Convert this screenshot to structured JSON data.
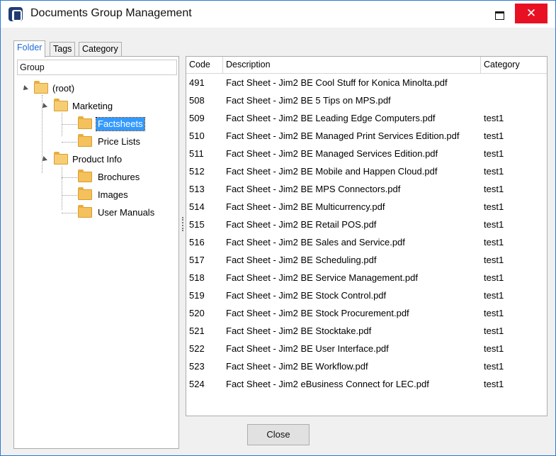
{
  "window": {
    "title": "Documents Group Management",
    "close_glyph": "✕",
    "accent": "#2b79d6",
    "close_color": "#e81123"
  },
  "tabs": [
    {
      "label": "Folder",
      "active": true
    },
    {
      "label": "Tags",
      "active": false
    },
    {
      "label": "Category",
      "active": false
    }
  ],
  "tree": {
    "header": "Group",
    "nodes": [
      {
        "label": "(root)",
        "icon": "folder-open-icon",
        "expanded": true
      },
      {
        "label": "Marketing",
        "icon": "folder-open-icon",
        "expanded": true
      },
      {
        "label": "Factsheets",
        "icon": "folder-icon",
        "selected": true
      },
      {
        "label": "Price Lists",
        "icon": "folder-icon"
      },
      {
        "label": "Product Info",
        "icon": "folder-open-icon",
        "expanded": true
      },
      {
        "label": "Brochures",
        "icon": "folder-icon"
      },
      {
        "label": "Images",
        "icon": "folder-icon"
      },
      {
        "label": "User Manuals",
        "icon": "folder-icon"
      }
    ]
  },
  "grid": {
    "columns": [
      "Code",
      "Description",
      "Category"
    ],
    "rows": [
      {
        "code": "491",
        "description": "Fact Sheet - Jim2 BE Cool Stuff for Konica Minolta.pdf",
        "category": ""
      },
      {
        "code": "508",
        "description": "Fact Sheet - Jim2 BE 5 Tips on MPS.pdf",
        "category": ""
      },
      {
        "code": "509",
        "description": "Fact Sheet - Jim2 BE Leading Edge Computers.pdf",
        "category": "test1"
      },
      {
        "code": "510",
        "description": "Fact Sheet - Jim2 BE Managed Print Services Edition.pdf",
        "category": "test1"
      },
      {
        "code": "511",
        "description": "Fact Sheet - Jim2 BE Managed Services Edition.pdf",
        "category": "test1"
      },
      {
        "code": "512",
        "description": "Fact Sheet - Jim2 BE Mobile and Happen Cloud.pdf",
        "category": "test1"
      },
      {
        "code": "513",
        "description": "Fact Sheet - Jim2 BE MPS Connectors.pdf",
        "category": "test1"
      },
      {
        "code": "514",
        "description": "Fact Sheet - Jim2 BE Multicurrency.pdf",
        "category": "test1"
      },
      {
        "code": "515",
        "description": "Fact Sheet - Jim2 BE Retail POS.pdf",
        "category": "test1"
      },
      {
        "code": "516",
        "description": "Fact Sheet - Jim2 BE Sales and Service.pdf",
        "category": "test1"
      },
      {
        "code": "517",
        "description": "Fact Sheet - Jim2 BE Scheduling.pdf",
        "category": "test1"
      },
      {
        "code": "518",
        "description": "Fact Sheet - Jim2 BE Service Management.pdf",
        "category": "test1"
      },
      {
        "code": "519",
        "description": "Fact Sheet - Jim2 BE Stock Control.pdf",
        "category": "test1"
      },
      {
        "code": "520",
        "description": "Fact Sheet - Jim2 BE Stock Procurement.pdf",
        "category": "test1"
      },
      {
        "code": "521",
        "description": "Fact Sheet - Jim2 BE Stocktake.pdf",
        "category": "test1"
      },
      {
        "code": "522",
        "description": "Fact Sheet - Jim2 BE User Interface.pdf",
        "category": "test1"
      },
      {
        "code": "523",
        "description": "Fact Sheet - Jim2 BE Workflow.pdf",
        "category": "test1"
      },
      {
        "code": "524",
        "description": "Fact Sheet - Jim2 eBusiness Connect for LEC.pdf",
        "category": "test1"
      }
    ]
  },
  "footer": {
    "close_label": "Close"
  }
}
